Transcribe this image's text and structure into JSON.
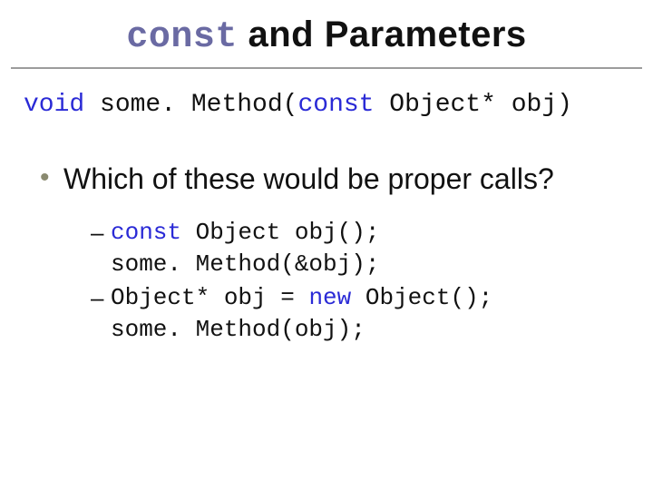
{
  "title": {
    "kw": "const",
    "rest": " and Parameters"
  },
  "signature": {
    "kw1": "void",
    "part1": " some. Method(",
    "kw2": "const",
    "part2": " Object* obj)"
  },
  "bullet": "Which of these would be proper calls?",
  "options": [
    {
      "kw": "const",
      "line1_rest": " Object obj();",
      "line2": "some. Method(&obj);"
    },
    {
      "line1_pre": "Object* obj = ",
      "kw": "new",
      "line1_post": " Object();",
      "line2": "some. Method(obj);"
    }
  ]
}
